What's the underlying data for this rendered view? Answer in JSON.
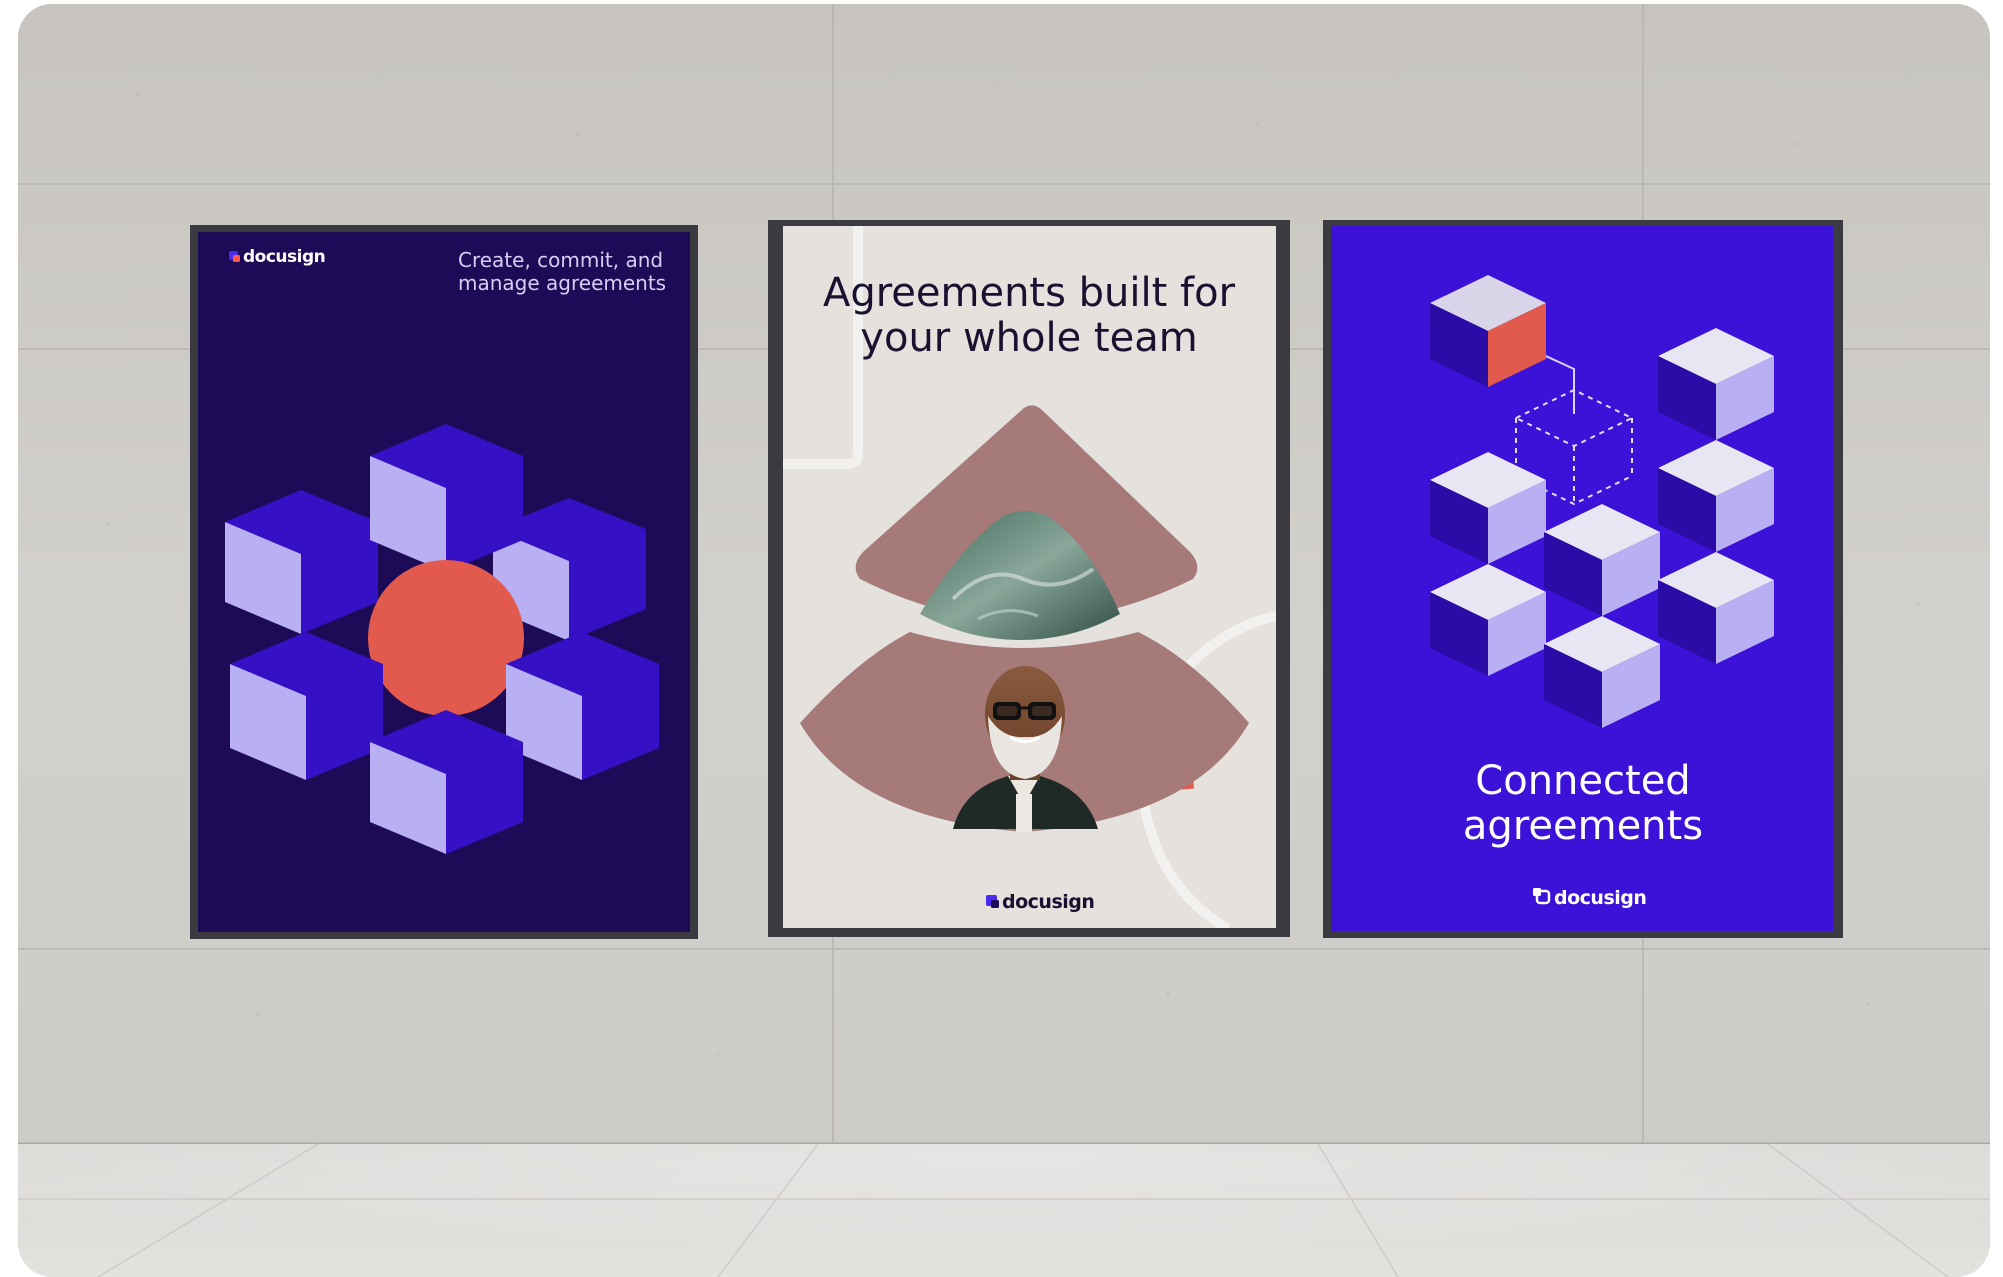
{
  "posters": [
    {
      "brand": "docusign",
      "tagline": [
        "Create, commit, and",
        "manage agreements"
      ]
    },
    {
      "headline": [
        "Agreements built for",
        "your whole team"
      ],
      "brand": "docusign"
    },
    {
      "headline": [
        "Connected",
        "agreements"
      ],
      "brand": "docusign"
    }
  ],
  "colors": {
    "poster1_bg": "#1e0b57",
    "poster2_bg": "#e5e1dd",
    "poster3_bg": "#3c11d8",
    "cube_top": "#3510c4",
    "cube_light": "#b8b0f2",
    "accent_red": "#e25a4e",
    "mauve": "#a57a79"
  }
}
